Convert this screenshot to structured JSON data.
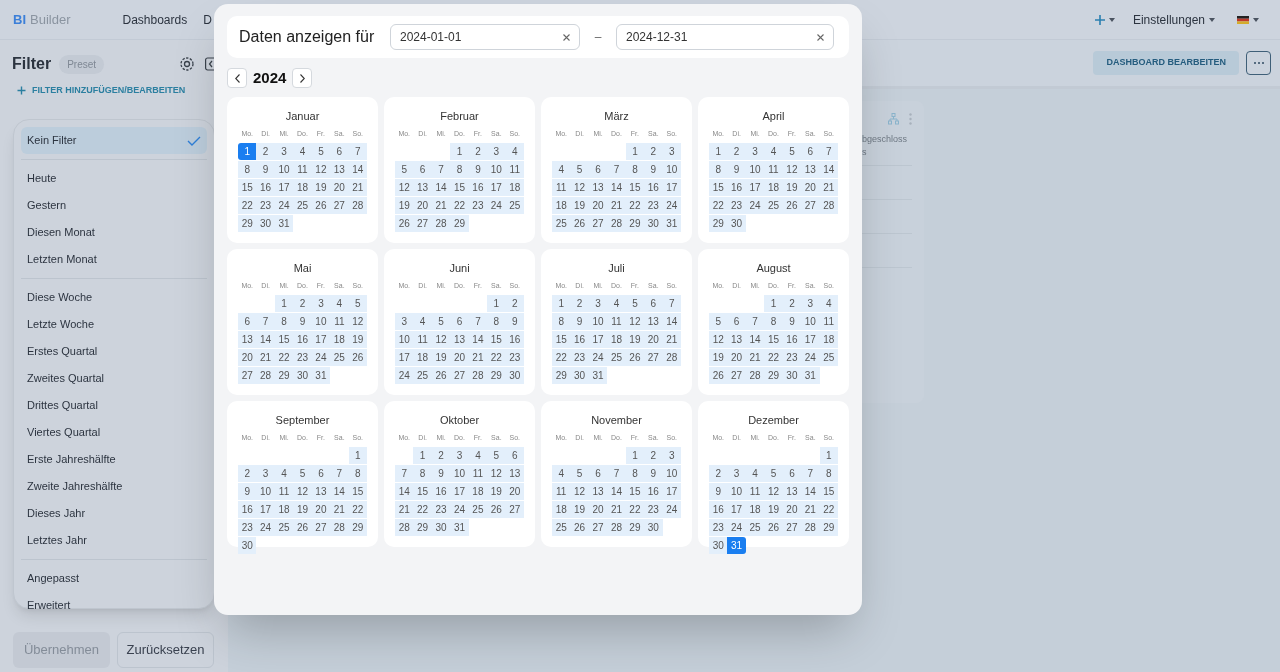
{
  "topbar": {
    "logo_mark": "BI",
    "logo_text": "Builder",
    "nav": [
      {
        "label": "Dashboards"
      },
      {
        "label": "D"
      }
    ],
    "settings": "Einstellungen"
  },
  "filter_panel": {
    "title": "Filter",
    "badge": "Preset",
    "add_link": "FILTER HINZUFÜGEN/BEARBEITEN",
    "presets": [
      [
        {
          "label": "Kein Filter",
          "selected": true
        }
      ],
      [
        {
          "label": "Heute",
          "selected": false
        },
        {
          "label": "Gestern",
          "selected": false
        },
        {
          "label": "Diesen Monat",
          "selected": false
        },
        {
          "label": "Letzten Monat",
          "selected": false
        }
      ],
      [
        {
          "label": "Diese Woche",
          "selected": false
        },
        {
          "label": "Letzte Woche",
          "selected": false
        },
        {
          "label": "Erstes Quartal",
          "selected": false
        },
        {
          "label": "Zweites Quartal",
          "selected": false
        },
        {
          "label": "Drittes Quartal",
          "selected": false
        },
        {
          "label": "Viertes Quartal",
          "selected": false
        },
        {
          "label": "Erste Jahreshälfte",
          "selected": false
        },
        {
          "label": "Zweite Jahreshälfte",
          "selected": false
        },
        {
          "label": "Dieses Jahr",
          "selected": false
        },
        {
          "label": "Letztes Jahr",
          "selected": false
        }
      ],
      [
        {
          "label": "Angepasst",
          "selected": false
        },
        {
          "label": "Erweitert",
          "selected": false
        }
      ]
    ],
    "buttons": [
      {
        "label": "Übernehmen",
        "disabled": true
      },
      {
        "label": "Zurücksetzen",
        "disabled": false
      }
    ]
  },
  "toolbar": {
    "edit_button": "DASHBOARD BEARBEITEN"
  },
  "card": {
    "lines": [
      "bgeschloss",
      "s"
    ]
  },
  "dialog": {
    "title": "Daten anzeigen für",
    "from": "2024-01-01",
    "separator": "–",
    "to": "2024-12-31",
    "year": "2024",
    "months": [
      {
        "name": "Januar",
        "weekdays": [
          "Mo.",
          "Di.",
          "Mi.",
          "Do.",
          "Fr.",
          "Sa.",
          "So."
        ],
        "start_selected": true,
        "end_selected": false,
        "days": [
          "1",
          "2",
          "3",
          "4",
          "5",
          "6",
          "7",
          "8",
          "9",
          "10",
          "11",
          "12",
          "13",
          "14",
          "15",
          "16",
          "17",
          "18",
          "19",
          "20",
          "21",
          "22",
          "23",
          "24",
          "25",
          "26",
          "27",
          "28",
          "29",
          "30",
          "31"
        ]
      },
      {
        "name": "Februar",
        "weekdays": [
          "Mo.",
          "Di.",
          "Mi.",
          "Do.",
          "Fr.",
          "Sa.",
          "So."
        ],
        "start_selected": false,
        "end_selected": false,
        "days": [
          "1",
          "2",
          "3",
          "4",
          "5",
          "6",
          "7",
          "8",
          "9",
          "10",
          "11",
          "12",
          "13",
          "14",
          "15",
          "16",
          "17",
          "18",
          "19",
          "20",
          "21",
          "22",
          "23",
          "24",
          "25",
          "26",
          "27",
          "28",
          "29"
        ]
      },
      {
        "name": "März",
        "weekdays": [
          "Mo.",
          "Di.",
          "Mi.",
          "Do.",
          "Fr.",
          "Sa.",
          "So."
        ],
        "start_selected": false,
        "end_selected": false,
        "days": [
          "1",
          "2",
          "3",
          "4",
          "5",
          "6",
          "7",
          "8",
          "9",
          "10",
          "11",
          "12",
          "13",
          "14",
          "15",
          "16",
          "17",
          "18",
          "19",
          "20",
          "21",
          "22",
          "23",
          "24",
          "25",
          "26",
          "27",
          "28",
          "29",
          "30",
          "31"
        ]
      },
      {
        "name": "April",
        "weekdays": [
          "Mo.",
          "Di.",
          "Mi.",
          "Do.",
          "Fr.",
          "Sa.",
          "So."
        ],
        "start_selected": false,
        "end_selected": false,
        "days": [
          "1",
          "2",
          "3",
          "4",
          "5",
          "6",
          "7",
          "8",
          "9",
          "10",
          "11",
          "12",
          "13",
          "14",
          "15",
          "16",
          "17",
          "18",
          "19",
          "20",
          "21",
          "22",
          "23",
          "24",
          "25",
          "26",
          "27",
          "28",
          "29",
          "30"
        ]
      },
      {
        "name": "Mai",
        "weekdays": [
          "Mo.",
          "Di.",
          "Mi.",
          "Do.",
          "Fr.",
          "Sa.",
          "So."
        ],
        "start_selected": false,
        "end_selected": false,
        "days": [
          "1",
          "2",
          "3",
          "4",
          "5",
          "6",
          "7",
          "8",
          "9",
          "10",
          "11",
          "12",
          "13",
          "14",
          "15",
          "16",
          "17",
          "18",
          "19",
          "20",
          "21",
          "22",
          "23",
          "24",
          "25",
          "26",
          "27",
          "28",
          "29",
          "30",
          "31"
        ]
      },
      {
        "name": "Juni",
        "weekdays": [
          "Mo.",
          "Di.",
          "Mi.",
          "Do.",
          "Fr.",
          "Sa.",
          "So."
        ],
        "start_selected": false,
        "end_selected": false,
        "days": [
          "1",
          "2",
          "3",
          "4",
          "5",
          "6",
          "7",
          "8",
          "9",
          "10",
          "11",
          "12",
          "13",
          "14",
          "15",
          "16",
          "17",
          "18",
          "19",
          "20",
          "21",
          "22",
          "23",
          "24",
          "25",
          "26",
          "27",
          "28",
          "29",
          "30"
        ]
      },
      {
        "name": "Juli",
        "weekdays": [
          "Mo.",
          "Di.",
          "Mi.",
          "Do.",
          "Fr.",
          "Sa.",
          "So."
        ],
        "start_selected": false,
        "end_selected": false,
        "days": [
          "1",
          "2",
          "3",
          "4",
          "5",
          "6",
          "7",
          "8",
          "9",
          "10",
          "11",
          "12",
          "13",
          "14",
          "15",
          "16",
          "17",
          "18",
          "19",
          "20",
          "21",
          "22",
          "23",
          "24",
          "25",
          "26",
          "27",
          "28",
          "29",
          "30",
          "31"
        ]
      },
      {
        "name": "August",
        "weekdays": [
          "Mo.",
          "Di.",
          "Mi.",
          "Do.",
          "Fr.",
          "Sa.",
          "So."
        ],
        "start_selected": false,
        "end_selected": false,
        "days": [
          "1",
          "2",
          "3",
          "4",
          "5",
          "6",
          "7",
          "8",
          "9",
          "10",
          "11",
          "12",
          "13",
          "14",
          "15",
          "16",
          "17",
          "18",
          "19",
          "20",
          "21",
          "22",
          "23",
          "24",
          "25",
          "26",
          "27",
          "28",
          "29",
          "30",
          "31"
        ]
      },
      {
        "name": "September",
        "weekdays": [
          "Mo.",
          "Di.",
          "Mi.",
          "Do.",
          "Fr.",
          "Sa.",
          "So."
        ],
        "start_selected": false,
        "end_selected": false,
        "days": [
          "1",
          "2",
          "3",
          "4",
          "5",
          "6",
          "7",
          "8",
          "9",
          "10",
          "11",
          "12",
          "13",
          "14",
          "15",
          "16",
          "17",
          "18",
          "19",
          "20",
          "21",
          "22",
          "23",
          "24",
          "25",
          "26",
          "27",
          "28",
          "29",
          "30"
        ]
      },
      {
        "name": "Oktober",
        "weekdays": [
          "Mo.",
          "Di.",
          "Mi.",
          "Do.",
          "Fr.",
          "Sa.",
          "So."
        ],
        "start_selected": false,
        "end_selected": false,
        "days": [
          "1",
          "2",
          "3",
          "4",
          "5",
          "6",
          "7",
          "8",
          "9",
          "10",
          "11",
          "12",
          "13",
          "14",
          "15",
          "16",
          "17",
          "18",
          "19",
          "20",
          "21",
          "22",
          "23",
          "24",
          "25",
          "26",
          "27",
          "28",
          "29",
          "30",
          "31"
        ]
      },
      {
        "name": "November",
        "weekdays": [
          "Mo.",
          "Di.",
          "Mi.",
          "Do.",
          "Fr.",
          "Sa.",
          "So."
        ],
        "start_selected": false,
        "end_selected": false,
        "days": [
          "1",
          "2",
          "3",
          "4",
          "5",
          "6",
          "7",
          "8",
          "9",
          "10",
          "11",
          "12",
          "13",
          "14",
          "15",
          "16",
          "17",
          "18",
          "19",
          "20",
          "21",
          "22",
          "23",
          "24",
          "25",
          "26",
          "27",
          "28",
          "29",
          "30"
        ]
      },
      {
        "name": "Dezember",
        "weekdays": [
          "Mo.",
          "Di.",
          "Mi.",
          "Do.",
          "Fr.",
          "Sa.",
          "So."
        ],
        "start_selected": false,
        "end_selected": true,
        "days": [
          "1",
          "2",
          "3",
          "4",
          "5",
          "6",
          "7",
          "8",
          "9",
          "10",
          "11",
          "12",
          "13",
          "14",
          "15",
          "16",
          "17",
          "18",
          "19",
          "20",
          "21",
          "22",
          "23",
          "24",
          "25",
          "26",
          "27",
          "28",
          "29",
          "30",
          "31"
        ]
      }
    ]
  }
}
